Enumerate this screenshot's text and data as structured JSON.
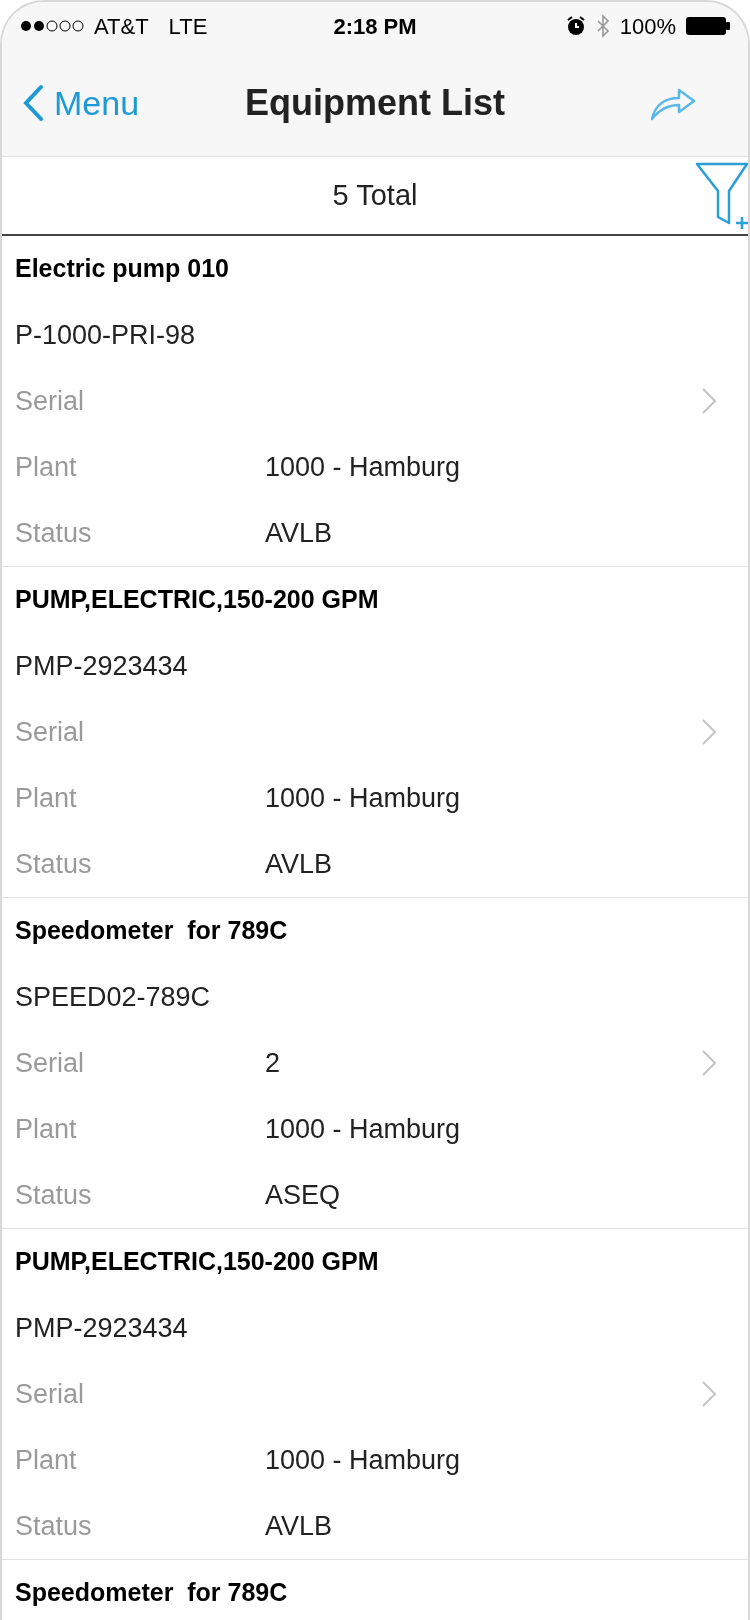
{
  "status_bar": {
    "carrier": "AT&T",
    "network": "LTE",
    "time": "2:18 PM",
    "battery": "100%"
  },
  "nav": {
    "back": "Menu",
    "title": "Equipment List"
  },
  "summary": {
    "total": "5 Total"
  },
  "items": [
    {
      "title": "Electric pump 010",
      "code": "P-1000-PRI-98",
      "rows": [
        {
          "label": "Serial"
        },
        {
          "label": "Plant",
          "value": "1000 - Hamburg"
        },
        {
          "label": "Status",
          "value": "AVLB"
        }
      ]
    },
    {
      "title": "PUMP,ELECTRIC,150-200 GPM",
      "code": "PMP-2923434",
      "rows": [
        {
          "label": "Serial"
        },
        {
          "label": "Plant",
          "value": "1000 - Hamburg"
        },
        {
          "label": "Status",
          "value": "AVLB"
        }
      ]
    },
    {
      "title": "Speedometer  for 789C",
      "code": "SPEED02-789C",
      "rows": [
        {
          "label": "Serial",
          "value": "2"
        },
        {
          "label": "Plant",
          "value": "1000 - Hamburg"
        },
        {
          "label": "Status",
          "value": "ASEQ"
        }
      ]
    },
    {
      "title": "PUMP,ELECTRIC,150-200 GPM",
      "code": "PMP-2923434",
      "rows": [
        {
          "label": "Serial"
        },
        {
          "label": "Plant",
          "value": "1000 - Hamburg"
        },
        {
          "label": "Status",
          "value": "AVLB"
        }
      ]
    },
    {
      "title": "Speedometer  for 789C"
    }
  ]
}
